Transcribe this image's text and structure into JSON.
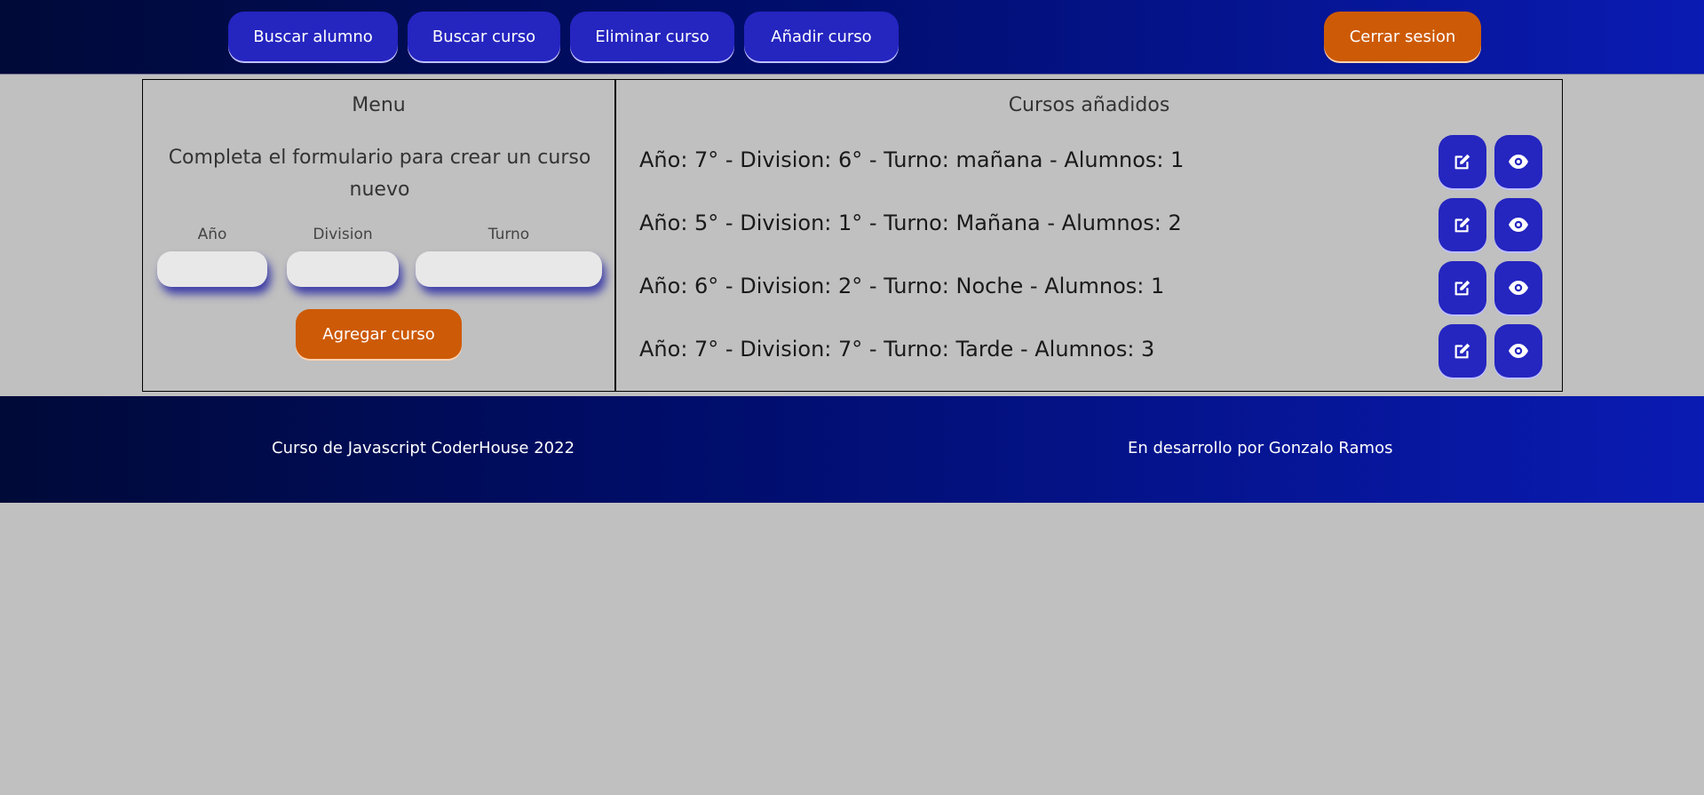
{
  "navbar": {
    "buttons": [
      {
        "label": "Buscar alumno"
      },
      {
        "label": "Buscar curso"
      },
      {
        "label": "Eliminar curso"
      },
      {
        "label": "Añadir curso"
      }
    ],
    "logout_label": "Cerrar sesion"
  },
  "menu": {
    "title": "Menu",
    "description": "Completa el formulario para crear un curso nuevo",
    "fields": {
      "year_label": "Año",
      "division_label": "Division",
      "shift_label": "Turno"
    },
    "submit_label": "Agregar curso"
  },
  "courses": {
    "title": "Cursos añadidos",
    "items": [
      {
        "text": "Año: 7° - Division: 6° - Turno: mañana - Alumnos: 1"
      },
      {
        "text": "Año: 5° - Division: 1° - Turno: Mañana - Alumnos: 2"
      },
      {
        "text": "Año: 6° - Division: 2° - Turno: Noche - Alumnos: 1"
      },
      {
        "text": "Año: 7° - Division: 7° - Turno: Tarde - Alumnos: 3"
      }
    ],
    "row_icons": [
      "edit-icon",
      "eye-icon"
    ]
  },
  "footer": {
    "left_text": "Curso de Javascript CoderHouse 2022",
    "right_text": "En desarrollo por Gonzalo Ramos"
  },
  "colors": {
    "primary_button": "#2525c0",
    "accent_button": "#cd5a06",
    "background": "#c0c0c0",
    "navbar_gradient_start": "#000a38",
    "navbar_gradient_end": "#0a1bb3"
  }
}
